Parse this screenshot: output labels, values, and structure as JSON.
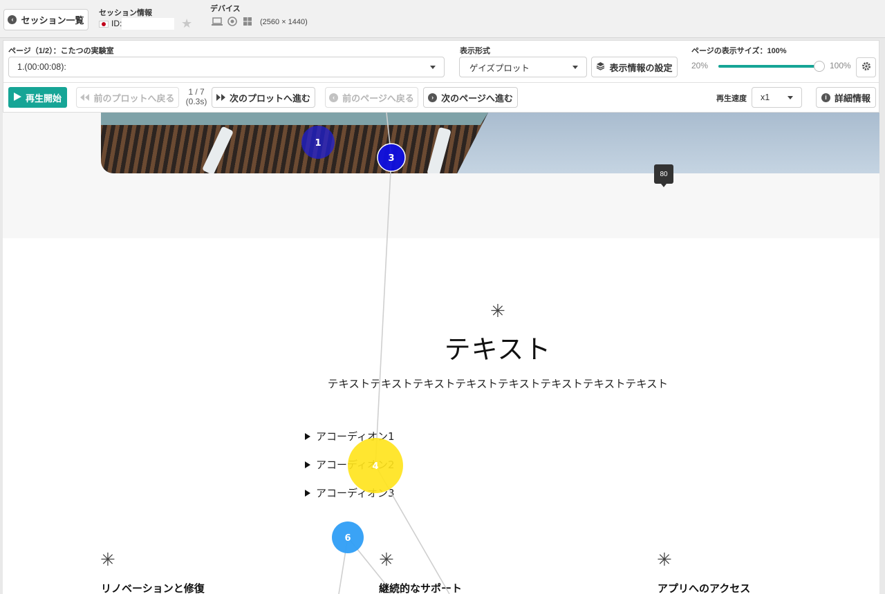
{
  "header": {
    "session_list_label": "セッション一覧",
    "session_info_label": "セッション情報",
    "id_label": "ID:",
    "device_label": "デバイス",
    "device_resolution": "(2560 × 1440)"
  },
  "controls": {
    "page_label": "ページ（1/2）：こたつの実験室",
    "page_select_value": "1.(00:00:08):",
    "display_format_label": "表示形式",
    "display_format_value": "ゲイズプロット",
    "display_settings_button": "表示情報の設定",
    "page_size_label": "ページの表示サイズ：100%",
    "slider_min": "20%",
    "slider_max": "100%",
    "slider_value": 1.0,
    "play_button": "再生開始",
    "prev_plot_button": "前のプロットへ戻る",
    "plot_counter": "1 / 7",
    "plot_time": "(0.3s)",
    "next_plot_button": "次のプロットへ進む",
    "prev_page_button": "前のページへ戻る",
    "next_page_button": "次のページへ進む",
    "speed_label": "再生速度",
    "speed_value": "x1",
    "details_button": "詳細情報"
  },
  "page": {
    "tooltip_value": "80",
    "heading": "テキスト",
    "body_text": "テキストテキストテキストテキストテキストテキストテキストテキスト",
    "accordions": [
      "アコーディオン1",
      "アコーディオン2",
      "アコーディオン3"
    ],
    "features": [
      "リノベーションと修復",
      "継続的なサポート",
      "アプリへのアクセス"
    ]
  },
  "gaze_points": [
    {
      "label": "1",
      "color": "#1f1fd0",
      "opacity": 0.75
    },
    {
      "label": "3",
      "color": "#1010e0",
      "opacity": 0.95
    },
    {
      "label": "4",
      "color": "#ffe31a",
      "opacity": 0.9
    },
    {
      "label": "6",
      "color": "#2f9ef5",
      "opacity": 0.95
    }
  ],
  "colors": {
    "accent": "#16a596",
    "tooltip_bg": "#333333"
  }
}
